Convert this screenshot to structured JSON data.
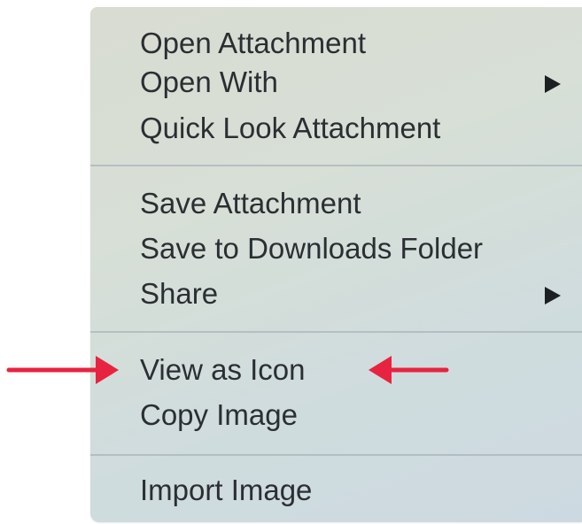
{
  "menu": {
    "groups": [
      {
        "items": [
          {
            "label": "Open Attachment",
            "submenu": false
          },
          {
            "label": "Open With",
            "submenu": true
          },
          {
            "label": "Quick Look Attachment",
            "submenu": false
          }
        ]
      },
      {
        "items": [
          {
            "label": "Save Attachment",
            "submenu": false
          },
          {
            "label": "Save to Downloads Folder",
            "submenu": false
          },
          {
            "label": "Share",
            "submenu": true
          }
        ]
      },
      {
        "items": [
          {
            "label": "View as Icon",
            "submenu": false
          },
          {
            "label": "Copy Image",
            "submenu": false
          }
        ]
      },
      {
        "items": [
          {
            "label": "Import Image",
            "submenu": false
          }
        ]
      }
    ]
  },
  "annotation": {
    "arrow_color": "#e8233f",
    "highlighted_item": "View as Icon"
  }
}
